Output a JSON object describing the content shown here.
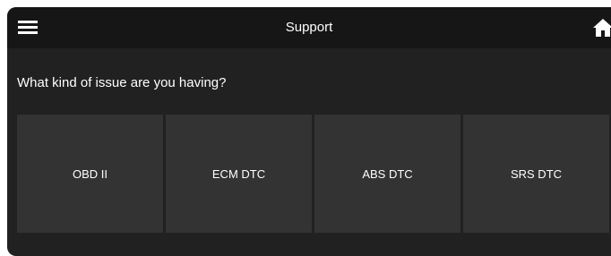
{
  "app_bar": {
    "title": "Support",
    "menu_icon": "hamburger-menu-icon",
    "home_icon": "home-icon"
  },
  "question": "What kind of issue are you having?",
  "issue_options": [
    {
      "label": "OBD II"
    },
    {
      "label": "ECM DTC"
    },
    {
      "label": "ABS DTC"
    },
    {
      "label": "SRS DTC"
    }
  ],
  "colors": {
    "app_bar_background": "#161616",
    "screen_background": "#212121",
    "tile_background": "#333333",
    "text": "#ffffff"
  }
}
